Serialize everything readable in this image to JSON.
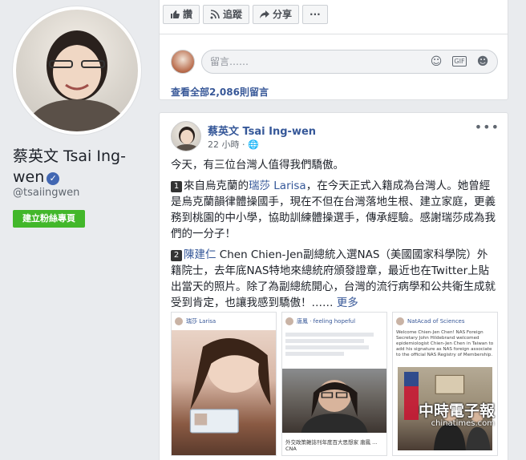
{
  "profile": {
    "name": "蔡英文 Tsai Ing-wen",
    "handle": "@tsaiingwen",
    "create_page_label": "建立粉絲專頁"
  },
  "action_bar": {
    "like_label": "讚",
    "follow_label": "追蹤",
    "share_label": "分享",
    "more_label": "···"
  },
  "comments": {
    "placeholder": "留言……",
    "view_all": "查看全部2,086則留言"
  },
  "post": {
    "author": "蔡英文 Tsai Ing-wen",
    "time": "22 小時 · ",
    "intro": "今天，有三位台灣人值得我們驕傲。",
    "p1_num": "1",
    "p1_a": "來自烏克蘭的",
    "p1_link": "瑞莎 Larisa",
    "p1_b": "，在今天正式入籍成為台灣人。她曾經是烏克蘭韻律體操國手，現在不但在台灣落地生根、建立家庭，更義務到桃園的中小學，協助訓練體操選手，傳承經驗。感謝瑞莎成為我們的一分子！",
    "p2_num": "2",
    "p2_link": "陳建仁",
    "p2_b": " Chen Chien-Jen副總統入選NAS（美國國家科學院）外籍院士，去年底NAS特地來總統府頒發證章，最近也在Twitter上貼出當天的照片。除了為副總統開心，台灣的流行病學和公共衛生成就受到肯定，也讓我感到驕傲！…… ",
    "more": "更多"
  },
  "images": [
    {
      "hdr": "瑞莎 Larisa",
      "text": ""
    },
    {
      "hdr": "唐鳳 · feeling hopeful",
      "text": "",
      "caption": "外交政策雜誌刊年度百大思想家 唐鳳 ... CNA"
    },
    {
      "hdr": "NatAcad of Sciences",
      "text": "Welcome Chien-Jen Chen! NAS Foreign Secretary John Hildebrand welcomed epidemiologist Chien-Jen Chen in Taiwan to add his signature as NAS foreign associate to the official NAS Registry of Membership."
    }
  ],
  "watermark": {
    "main": "中時電子報",
    "sub": "chinatimes.com"
  }
}
